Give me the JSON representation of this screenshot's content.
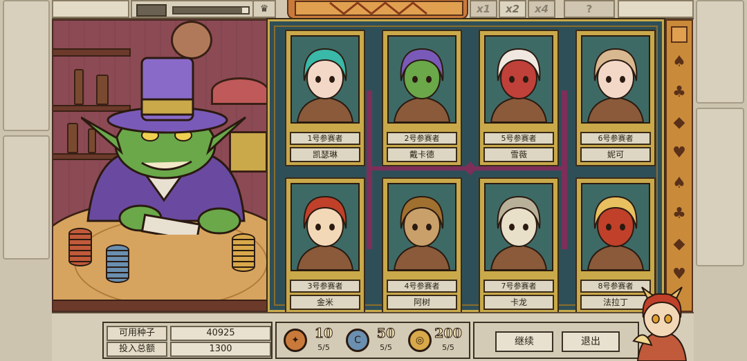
{
  "top_bar": {
    "progress": 0.92,
    "speed_buttons": [
      {
        "label": "x1",
        "active": false
      },
      {
        "label": "x2",
        "active": true
      },
      {
        "label": "x4",
        "active": false
      }
    ],
    "help_label": "?"
  },
  "participants": [
    {
      "number_label": "1号参赛者",
      "name": "凯瑟琳",
      "portrait": "teal-hair-girl-portrait"
    },
    {
      "number_label": "2号参赛者",
      "name": "戴卡德",
      "portrait": "goblin-top-hat-portrait"
    },
    {
      "number_label": "5号参赛者",
      "name": "雪薇",
      "portrait": "red-horned-woman-portrait"
    },
    {
      "number_label": "6号参赛者",
      "name": "妮可",
      "portrait": "cat-girl-portrait"
    },
    {
      "number_label": "3号参赛者",
      "name": "金米",
      "portrait": "horned-girl-portrait"
    },
    {
      "number_label": "4号参赛者",
      "name": "阿树",
      "portrait": "elf-man-portrait"
    },
    {
      "number_label": "7号参赛者",
      "name": "卡龙",
      "portrait": "skeleton-dragon-portrait"
    },
    {
      "number_label": "8号参赛者",
      "name": "法拉丁",
      "portrait": "red-orb-portrait"
    }
  ],
  "stats": {
    "available_seeds_label": "可用种子",
    "available_seeds_value": "40925",
    "total_bet_label": "投入总额",
    "total_bet_value": "1300"
  },
  "chips": [
    {
      "value": "10",
      "count": "5/5",
      "color": "#c97a3a",
      "icon": "compass-chip-icon"
    },
    {
      "value": "50",
      "count": "5/5",
      "color": "#6a8fb0",
      "icon": "c-chip-icon"
    },
    {
      "value": "200",
      "count": "5/5",
      "color": "#d8a84a",
      "icon": "coin-chip-icon"
    }
  ],
  "actions": {
    "continue_label": "继续",
    "exit_label": "退出"
  },
  "suits": [
    "♠",
    "♣",
    "◆",
    "♥",
    "♠",
    "♣",
    "◆",
    "♥"
  ],
  "colors": {
    "board_bg": "#2f4f58",
    "card_frame": "#c9a94a",
    "connector": "#7d2f5a",
    "dealer_wall": "#8c4a55"
  }
}
